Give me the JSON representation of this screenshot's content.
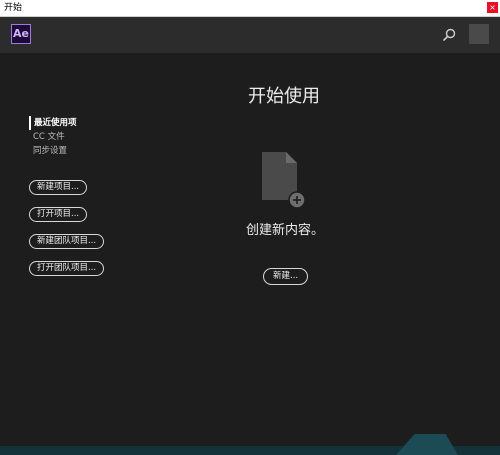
{
  "window": {
    "title": "开始",
    "close_label": "×"
  },
  "header": {
    "app_logo": "Ae"
  },
  "sidebar": {
    "nav": [
      {
        "label": "最近使用项",
        "active": true
      },
      {
        "label": "CC 文件",
        "active": false
      },
      {
        "label": "同步设置",
        "active": false
      }
    ],
    "buttons": [
      {
        "label": "新建项目..."
      },
      {
        "label": "打开项目..."
      },
      {
        "label": "新建团队项目..."
      },
      {
        "label": "打开团队项目..."
      }
    ]
  },
  "main": {
    "title": "开始使用",
    "subtitle": "创建新内容。",
    "new_button": "新建..."
  },
  "icons": {
    "search": "search-icon",
    "document_add": "document-add-icon"
  },
  "colors": {
    "background": "#1d1d1d",
    "header": "#2c2c2c",
    "ae_brand": "#9b7ae2",
    "close_red": "#e81123"
  }
}
